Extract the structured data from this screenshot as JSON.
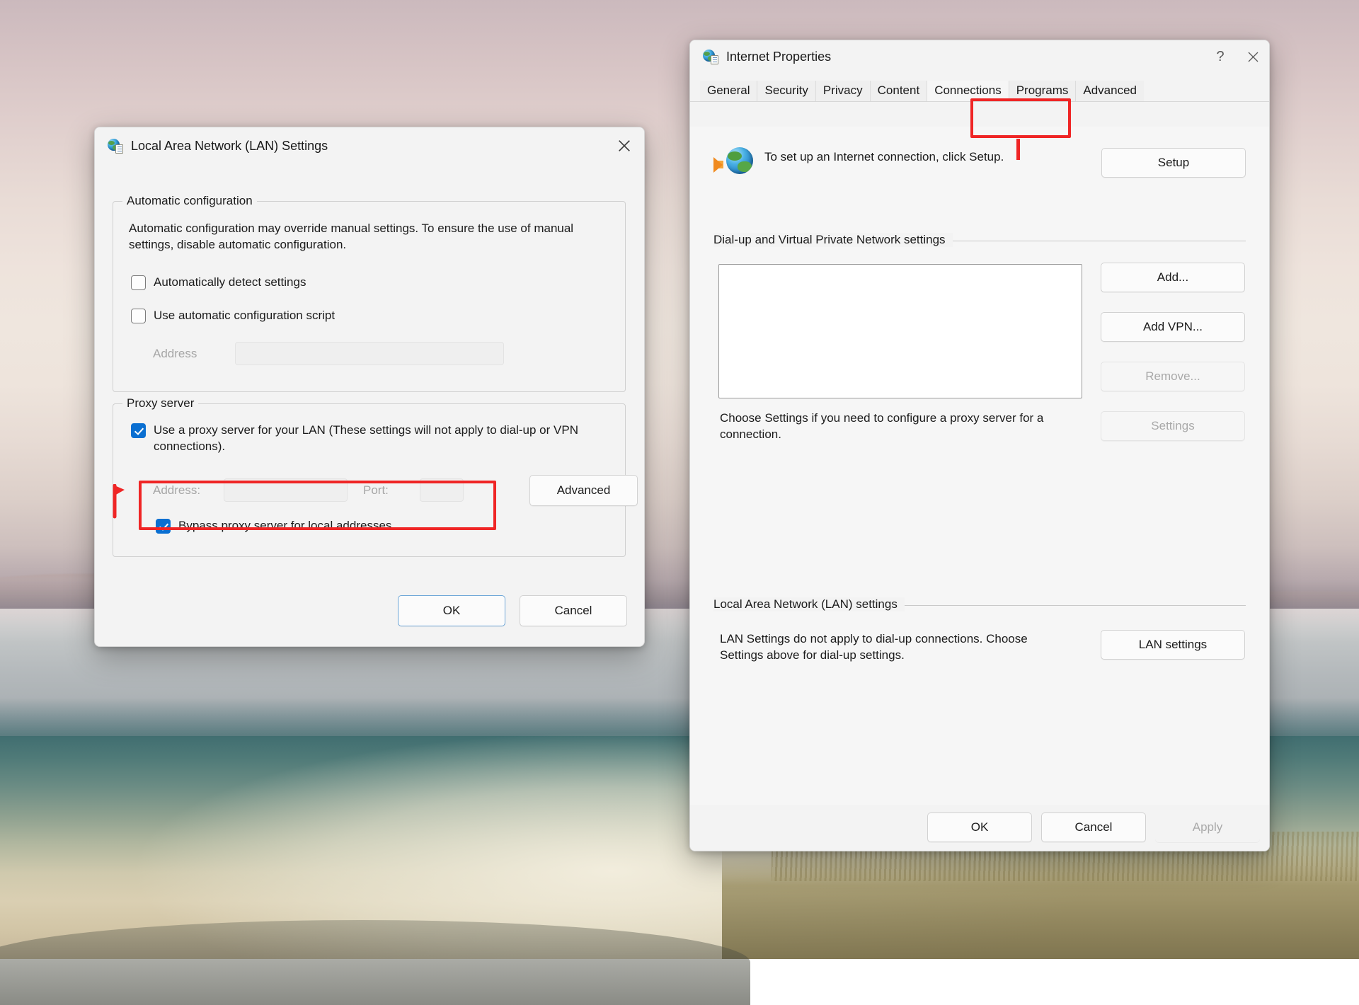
{
  "lan_dialog": {
    "title": "Local Area Network (LAN) Settings",
    "title_icon": "internet-options-globe-icon",
    "close_label": "✕",
    "auto_group": {
      "legend": "Automatic configuration",
      "description": "Automatic configuration may override manual settings.  To ensure the use of manual settings, disable automatic configuration.",
      "checkboxes": [
        {
          "label": "Automatically detect settings",
          "checked": false
        },
        {
          "label": "Use automatic configuration script",
          "checked": false
        }
      ],
      "address_label": "Address",
      "address_value": "",
      "address_disabled": true
    },
    "proxy_group": {
      "legend": "Proxy server",
      "use_proxy": {
        "label": "Use a proxy server for your LAN (These settings will not apply to dial-up or VPN connections).",
        "checked": true
      },
      "address_label": "Address:",
      "address_value": "",
      "port_label": "Port:",
      "port_value": "",
      "advanced_button": "Advanced",
      "bypass": {
        "label": "Bypass proxy server for local addresses",
        "checked": true
      }
    },
    "buttons": {
      "ok": "OK",
      "cancel": "Cancel"
    }
  },
  "internet_properties": {
    "title": "Internet Properties",
    "title_icon": "internet-options-globe-icon",
    "help_label": "?",
    "close_label": "✕",
    "tabs": [
      {
        "label": "General",
        "active": false
      },
      {
        "label": "Security",
        "active": false
      },
      {
        "label": "Privacy",
        "active": false
      },
      {
        "label": "Content",
        "active": false
      },
      {
        "label": "Connections",
        "active": true
      },
      {
        "label": "Programs",
        "active": false
      },
      {
        "label": "Advanced",
        "active": false
      }
    ],
    "setup_row": {
      "icon": "globe-with-arrow-icon",
      "text": "To set up an Internet connection, click Setup.",
      "button": "Setup"
    },
    "dialup_group": {
      "title": "Dial-up and Virtual Private Network settings",
      "list_items": [],
      "buttons": [
        {
          "label": "Add...",
          "disabled": false
        },
        {
          "label": "Add VPN...",
          "disabled": false
        },
        {
          "label": "Remove...",
          "disabled": true
        }
      ],
      "hint": "Choose Settings if you need to configure a proxy server for a connection.",
      "settings_button": {
        "label": "Settings",
        "disabled": true
      }
    },
    "lan_group": {
      "title": "Local Area Network (LAN) settings",
      "hint": "LAN Settings do not apply to dial-up connections. Choose Settings above for dial-up settings.",
      "button": "LAN settings"
    },
    "buttons": {
      "ok": "OK",
      "cancel": "Cancel",
      "apply": {
        "label": "Apply",
        "disabled": true
      }
    }
  },
  "annotations": {
    "accent_color": "#ef2525",
    "connections_tab_highlight": "Connections",
    "proxy_address_row_highlight": "Address: / Port:"
  }
}
